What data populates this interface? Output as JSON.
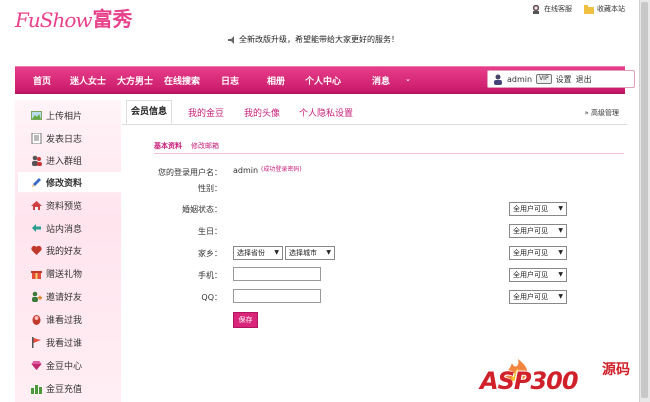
{
  "logo": {
    "en": "FuShow",
    "cn": "富秀"
  },
  "top_links": {
    "service": "在线客服",
    "favorite": "收藏本站"
  },
  "notice": "全新改版升级，希望能带给大家更好的服务！",
  "nav": {
    "items": [
      "首页",
      "迷人女士",
      "大方男士",
      "在线搜索",
      "日志",
      "相册",
      "个人中心",
      "消息"
    ],
    "user": "admin",
    "vip": "VIP",
    "settings": "设置",
    "logout": "退出"
  },
  "sidebar": {
    "items": [
      {
        "label": "上传相片",
        "icon": "photo-icon"
      },
      {
        "label": "发表日志",
        "icon": "document-icon"
      },
      {
        "label": "进入群组",
        "icon": "group-icon"
      },
      {
        "label": "修改资料",
        "icon": "pencil-icon"
      },
      {
        "label": "资料预览",
        "icon": "preview-icon"
      },
      {
        "label": "站内消息",
        "icon": "message-icon"
      },
      {
        "label": "我的好友",
        "icon": "heart-icon"
      },
      {
        "label": "赠送礼物",
        "icon": "gift-icon"
      },
      {
        "label": "邀请好友",
        "icon": "invite-icon"
      },
      {
        "label": "谁看过我",
        "icon": "visitor-icon"
      },
      {
        "label": "我看过谁",
        "icon": "flag-icon"
      },
      {
        "label": "金豆中心",
        "icon": "diamond-icon"
      },
      {
        "label": "金豆充值",
        "icon": "recharge-icon"
      }
    ]
  },
  "tabs": [
    "会员信息",
    "我的金豆",
    "我的头像",
    "个人隐私设置"
  ],
  "advanced": "» 高级管理",
  "subtabs": {
    "basic": "基本资料",
    "email": "修改邮箱"
  },
  "form": {
    "username_label": "您的登录用户名：",
    "username": "admin",
    "username_note": "(成功登录密码)",
    "gender_label": "性别：",
    "marital_label": "婚姻状态：",
    "birthday_label": "生日：",
    "hometown_label": "家乡：",
    "province_select": "选择省份",
    "city_select": "选择城市",
    "mobile_label": "手机：",
    "qq_label": "QQ：",
    "visibility": "全用户可见",
    "save": "保存"
  },
  "watermark": {
    "text": "ASP300",
    "cn": "源码"
  },
  "colors": {
    "brand": "#d9267a",
    "nav": "#d92a7a"
  }
}
